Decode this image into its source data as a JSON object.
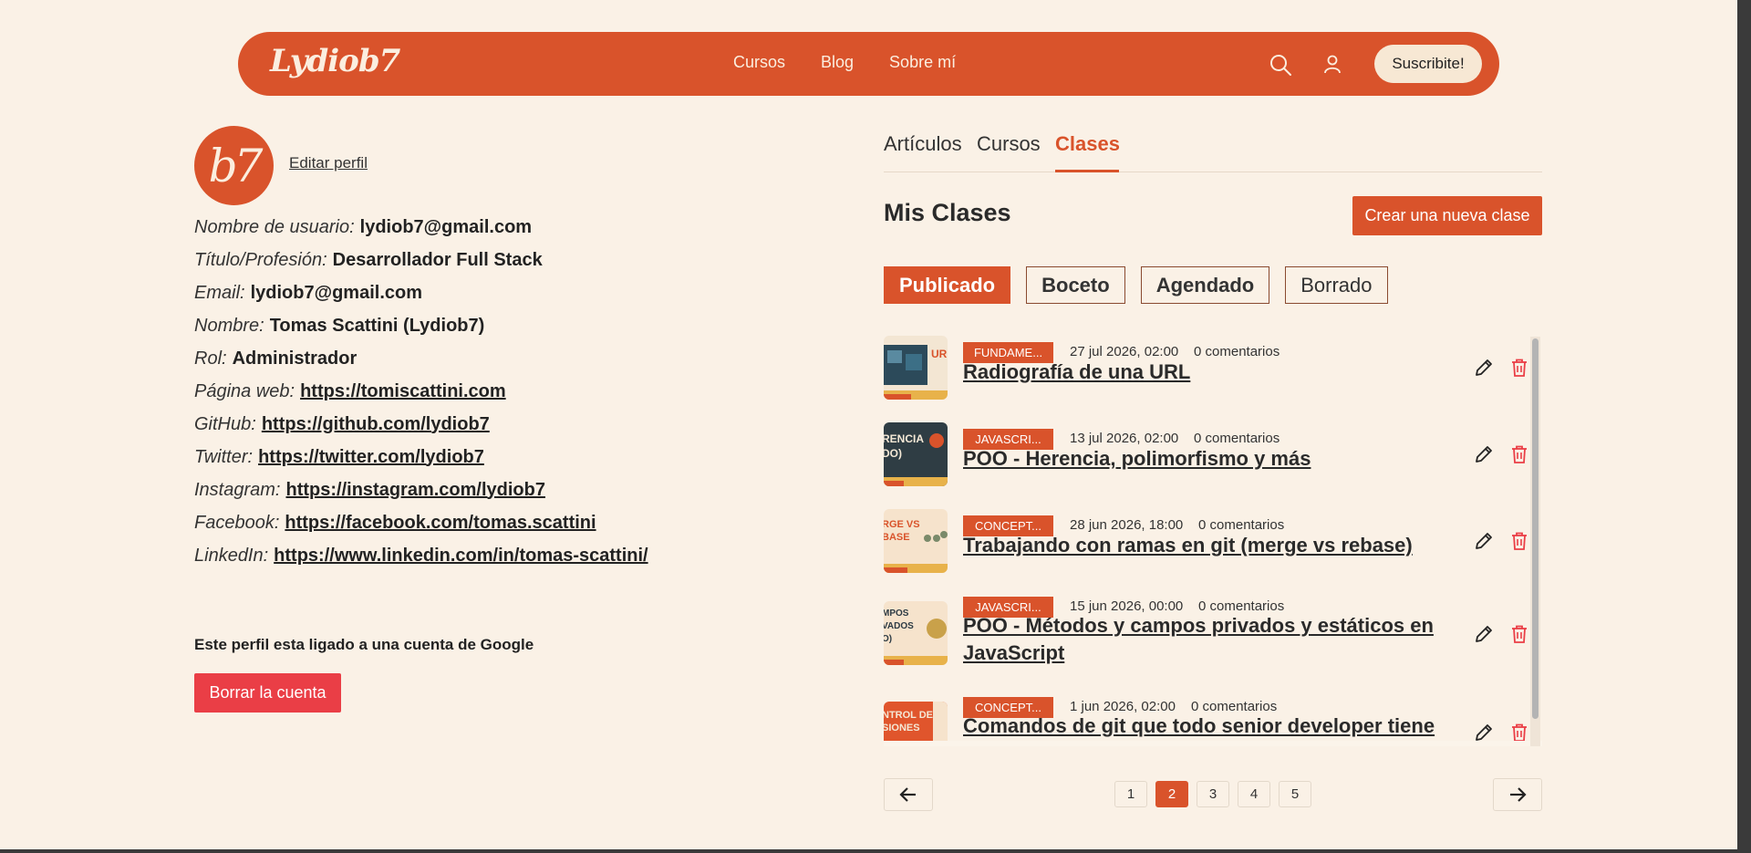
{
  "header": {
    "logo": "Lydiob7",
    "nav": [
      "Cursos",
      "Blog",
      "Sobre mí"
    ],
    "subscribe_label": "Suscribite!"
  },
  "profile": {
    "avatar_text": "b7",
    "edit_label": "Editar perfil",
    "rows": [
      {
        "label": "Nombre de usuario:",
        "value": "lydiob7@gmail.com",
        "link": false
      },
      {
        "label": "Título/Profesión:",
        "value": "Desarrollador Full Stack",
        "link": false
      },
      {
        "label": "Email:",
        "value": "lydiob7@gmail.com",
        "link": false
      },
      {
        "label": "Nombre:",
        "value": "Tomas Scattini (Lydiob7)",
        "link": false
      },
      {
        "label": "Rol:",
        "value": "Administrador",
        "link": false
      },
      {
        "label": "Página web:",
        "value": "https://tomiscattini.com",
        "link": true
      },
      {
        "label": "GitHub:",
        "value": "https://github.com/lydiob7",
        "link": true
      },
      {
        "label": "Twitter:",
        "value": "https://twitter.com/lydiob7",
        "link": true
      },
      {
        "label": "Instagram:",
        "value": "https://instagram.com/lydiob7",
        "link": true
      },
      {
        "label": "Facebook:",
        "value": "https://facebook.com/tomas.scattini",
        "link": true
      },
      {
        "label": "LinkedIn:",
        "value": "https://www.linkedin.com/in/tomas-scattini/",
        "link": true
      }
    ],
    "google_note": "Este perfil esta ligado a una cuenta de Google",
    "delete_label": "Borrar la cuenta"
  },
  "content": {
    "tabs": [
      "Artículos",
      "Cursos",
      "Clases"
    ],
    "active_tab": "Clases",
    "section_title": "Mis Clases",
    "create_label": "Crear una nueva clase",
    "filters": [
      "Publicado",
      "Boceto",
      "Agendado",
      "Borrado"
    ],
    "active_filter": "Publicado",
    "items": [
      {
        "badge": "FUNDAME...",
        "date": "27 jul 2026, 02:00",
        "comments": "0 comentarios",
        "title": "Radiografía de una URL",
        "thumb_text": "UR"
      },
      {
        "badge": "JAVASCRI...",
        "date": "13 jul 2026, 02:00",
        "comments": "0 comentarios",
        "title": "POO - Herencia, polimorfismo y más",
        "thumb_text": "RENCIA DO)"
      },
      {
        "badge": "CONCEPT...",
        "date": "28 jun 2026, 18:00",
        "comments": "0 comentarios",
        "title": "Trabajando con ramas en git (merge vs rebase)",
        "thumb_text": "RGE VS BASE"
      },
      {
        "badge": "JAVASCRI...",
        "date": "15 jun 2026, 00:00",
        "comments": "0 comentarios",
        "title": "POO - Métodos y campos privados y estáticos en JavaScript",
        "thumb_text": "MPOS VADOS O)"
      },
      {
        "badge": "CONCEPT...",
        "date": "1 jun 2026, 02:00",
        "comments": "0 comentarios",
        "title": "Comandos de git que todo senior developer tiene",
        "thumb_text": "NTROL DE SIONES"
      }
    ]
  },
  "pagination": {
    "pages": [
      "1",
      "2",
      "3",
      "4",
      "5"
    ],
    "current": "2"
  },
  "colors": {
    "accent": "#d9532b",
    "background": "#faf1e6",
    "danger": "#ea3e46"
  }
}
